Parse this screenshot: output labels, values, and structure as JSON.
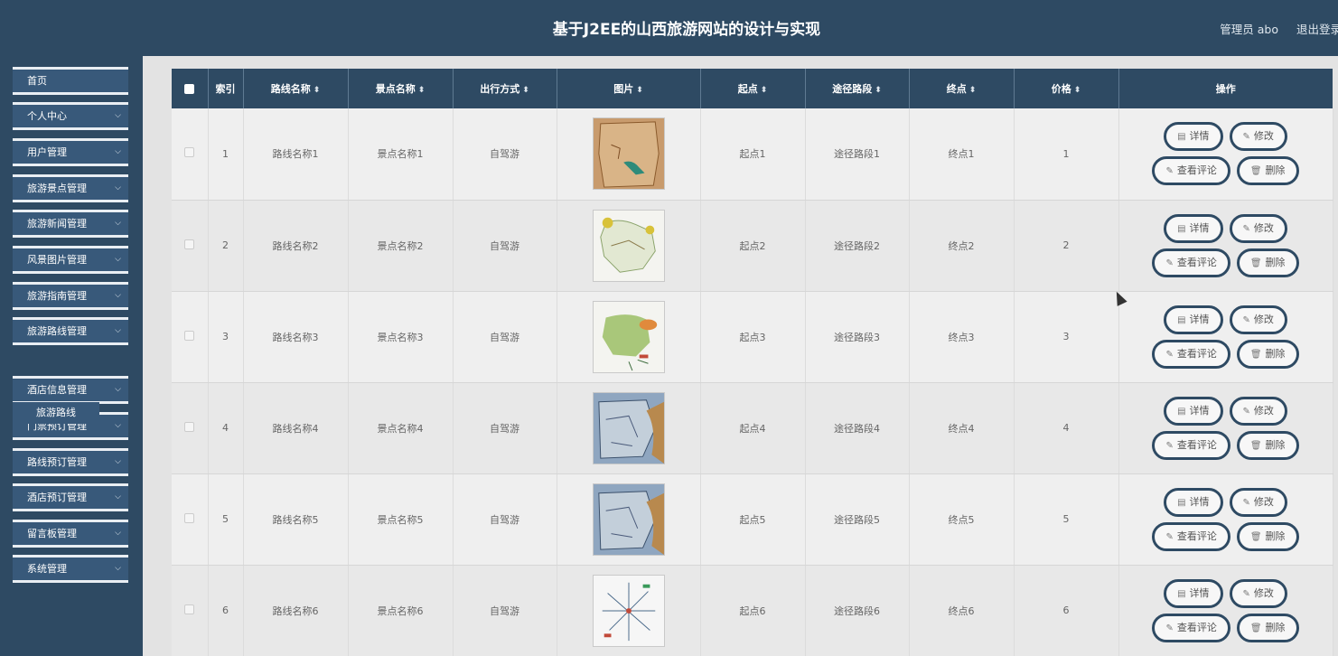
{
  "header": {
    "title": "基于J2EE的山西旅游网站的设计与实现",
    "admin_label": "管理员 abo",
    "logout_label": "退出登录"
  },
  "sidebar": {
    "items": [
      {
        "label": "首页",
        "expandable": false
      },
      {
        "label": "个人中心",
        "expandable": true
      },
      {
        "label": "用户管理",
        "expandable": true
      },
      {
        "label": "旅游景点管理",
        "expandable": true
      },
      {
        "label": "旅游新闻管理",
        "expandable": true
      },
      {
        "label": "风景图片管理",
        "expandable": true
      },
      {
        "label": "旅游指南管理",
        "expandable": true
      },
      {
        "label": "旅游路线管理",
        "expandable": true
      },
      {
        "label": "酒店信息管理",
        "expandable": true
      },
      {
        "label": "门票预订管理",
        "expandable": true
      },
      {
        "label": "路线预订管理",
        "expandable": true
      },
      {
        "label": "酒店预订管理",
        "expandable": true
      },
      {
        "label": "留言板管理",
        "expandable": true
      },
      {
        "label": "系统管理",
        "expandable": true
      }
    ],
    "active_sub": "旅游路线",
    "chevron_icon": "chevron-down-icon"
  },
  "table": {
    "headers": [
      "索引",
      "路线名称",
      "景点名称",
      "出行方式",
      "图片",
      "起点",
      "途径路段",
      "终点",
      "价格",
      "操作"
    ],
    "sortable": [
      false,
      true,
      true,
      true,
      true,
      true,
      true,
      true,
      true,
      false
    ],
    "rows": [
      {
        "index": "1",
        "route": "路线名称1",
        "spot": "景点名称1",
        "mode": "自驾游",
        "image": "map-thumbnail-1",
        "start": "起点1",
        "via": "途径路段1",
        "end": "终点1",
        "price": "1"
      },
      {
        "index": "2",
        "route": "路线名称2",
        "spot": "景点名称2",
        "mode": "自驾游",
        "image": "map-thumbnail-2",
        "start": "起点2",
        "via": "途径路段2",
        "end": "终点2",
        "price": "2"
      },
      {
        "index": "3",
        "route": "路线名称3",
        "spot": "景点名称3",
        "mode": "自驾游",
        "image": "map-thumbnail-3",
        "start": "起点3",
        "via": "途径路段3",
        "end": "终点3",
        "price": "3"
      },
      {
        "index": "4",
        "route": "路线名称4",
        "spot": "景点名称4",
        "mode": "自驾游",
        "image": "map-thumbnail-4",
        "start": "起点4",
        "via": "途径路段4",
        "end": "终点4",
        "price": "4"
      },
      {
        "index": "5",
        "route": "路线名称5",
        "spot": "景点名称5",
        "mode": "自驾游",
        "image": "map-thumbnail-5",
        "start": "起点5",
        "via": "途径路段5",
        "end": "终点5",
        "price": "5"
      },
      {
        "index": "6",
        "route": "路线名称6",
        "spot": "景点名称6",
        "mode": "自驾游",
        "image": "map-thumbnail-6",
        "start": "起点6",
        "via": "途径路段6",
        "end": "终点6",
        "price": "6"
      }
    ],
    "actions": {
      "detail": "详情",
      "edit": "修改",
      "comments": "查看评论",
      "delete": "删除"
    },
    "action_icons": {
      "detail": "document-icon",
      "edit": "pencil-icon",
      "comments": "pencil-icon",
      "delete": "trash-icon"
    }
  },
  "colors": {
    "primary": "#2e4a63",
    "sidebar_item": "#38597a",
    "page_bg": "#e3e3e3"
  }
}
